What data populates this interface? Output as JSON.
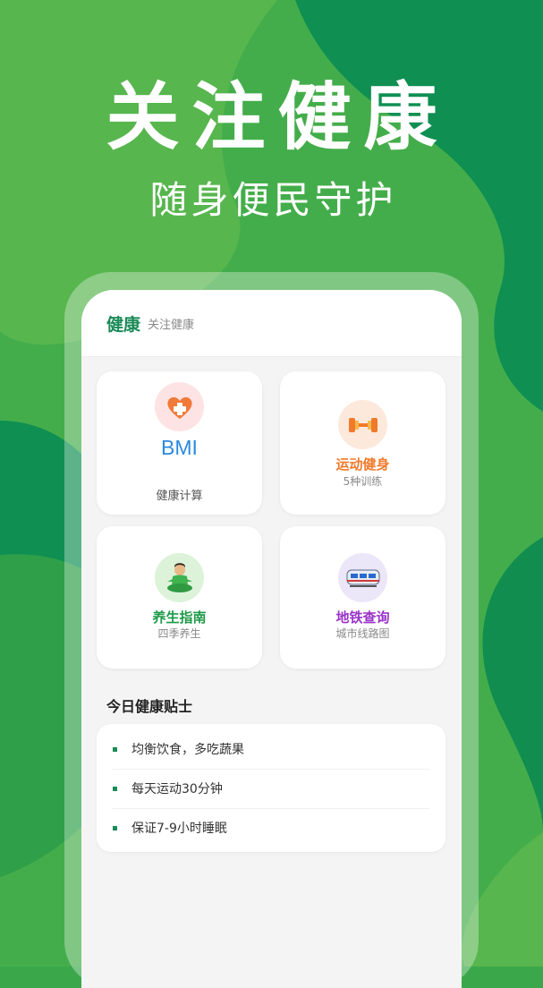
{
  "hero": {
    "title": "关注健康",
    "subtitle": "随身便民守护"
  },
  "app": {
    "title": "健康",
    "subtitle": "关注健康"
  },
  "cards": [
    {
      "big_label": "BMI",
      "name": "",
      "desc": "健康计算",
      "icon": "heart-plus-icon",
      "color": "#2a8ae0"
    },
    {
      "big_label": "",
      "name": "运动健身",
      "desc": "5种训练",
      "icon": "dumbbell-icon",
      "color": "#f07a2a"
    },
    {
      "big_label": "",
      "name": "养生指南",
      "desc": "四季养生",
      "icon": "meditation-person-icon",
      "color": "#1e9a48"
    },
    {
      "big_label": "",
      "name": "地铁查询",
      "desc": "城市线路图",
      "icon": "metro-train-icon",
      "color": "#9a33c8"
    }
  ],
  "tips": {
    "title": "今日健康贴士",
    "items": [
      "均衡饮食，多吃蔬果",
      "每天运动30分钟",
      "保证7-9小时睡眠"
    ]
  },
  "colors": {
    "accent": "#1a8a57",
    "background_green": "#3aa84a",
    "dark_green": "#0f8f52"
  }
}
